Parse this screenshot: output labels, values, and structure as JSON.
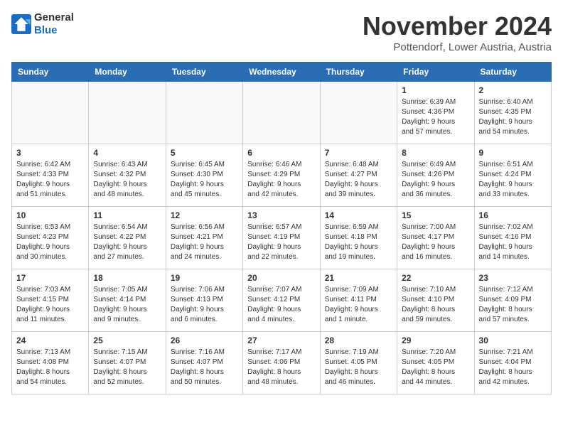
{
  "header": {
    "logo_line1": "General",
    "logo_line2": "Blue",
    "month": "November 2024",
    "location": "Pottendorf, Lower Austria, Austria"
  },
  "weekdays": [
    "Sunday",
    "Monday",
    "Tuesday",
    "Wednesday",
    "Thursday",
    "Friday",
    "Saturday"
  ],
  "weeks": [
    [
      {
        "day": "",
        "info": ""
      },
      {
        "day": "",
        "info": ""
      },
      {
        "day": "",
        "info": ""
      },
      {
        "day": "",
        "info": ""
      },
      {
        "day": "",
        "info": ""
      },
      {
        "day": "1",
        "info": "Sunrise: 6:39 AM\nSunset: 4:36 PM\nDaylight: 9 hours\nand 57 minutes."
      },
      {
        "day": "2",
        "info": "Sunrise: 6:40 AM\nSunset: 4:35 PM\nDaylight: 9 hours\nand 54 minutes."
      }
    ],
    [
      {
        "day": "3",
        "info": "Sunrise: 6:42 AM\nSunset: 4:33 PM\nDaylight: 9 hours\nand 51 minutes."
      },
      {
        "day": "4",
        "info": "Sunrise: 6:43 AM\nSunset: 4:32 PM\nDaylight: 9 hours\nand 48 minutes."
      },
      {
        "day": "5",
        "info": "Sunrise: 6:45 AM\nSunset: 4:30 PM\nDaylight: 9 hours\nand 45 minutes."
      },
      {
        "day": "6",
        "info": "Sunrise: 6:46 AM\nSunset: 4:29 PM\nDaylight: 9 hours\nand 42 minutes."
      },
      {
        "day": "7",
        "info": "Sunrise: 6:48 AM\nSunset: 4:27 PM\nDaylight: 9 hours\nand 39 minutes."
      },
      {
        "day": "8",
        "info": "Sunrise: 6:49 AM\nSunset: 4:26 PM\nDaylight: 9 hours\nand 36 minutes."
      },
      {
        "day": "9",
        "info": "Sunrise: 6:51 AM\nSunset: 4:24 PM\nDaylight: 9 hours\nand 33 minutes."
      }
    ],
    [
      {
        "day": "10",
        "info": "Sunrise: 6:53 AM\nSunset: 4:23 PM\nDaylight: 9 hours\nand 30 minutes."
      },
      {
        "day": "11",
        "info": "Sunrise: 6:54 AM\nSunset: 4:22 PM\nDaylight: 9 hours\nand 27 minutes."
      },
      {
        "day": "12",
        "info": "Sunrise: 6:56 AM\nSunset: 4:21 PM\nDaylight: 9 hours\nand 24 minutes."
      },
      {
        "day": "13",
        "info": "Sunrise: 6:57 AM\nSunset: 4:19 PM\nDaylight: 9 hours\nand 22 minutes."
      },
      {
        "day": "14",
        "info": "Sunrise: 6:59 AM\nSunset: 4:18 PM\nDaylight: 9 hours\nand 19 minutes."
      },
      {
        "day": "15",
        "info": "Sunrise: 7:00 AM\nSunset: 4:17 PM\nDaylight: 9 hours\nand 16 minutes."
      },
      {
        "day": "16",
        "info": "Sunrise: 7:02 AM\nSunset: 4:16 PM\nDaylight: 9 hours\nand 14 minutes."
      }
    ],
    [
      {
        "day": "17",
        "info": "Sunrise: 7:03 AM\nSunset: 4:15 PM\nDaylight: 9 hours\nand 11 minutes."
      },
      {
        "day": "18",
        "info": "Sunrise: 7:05 AM\nSunset: 4:14 PM\nDaylight: 9 hours\nand 9 minutes."
      },
      {
        "day": "19",
        "info": "Sunrise: 7:06 AM\nSunset: 4:13 PM\nDaylight: 9 hours\nand 6 minutes."
      },
      {
        "day": "20",
        "info": "Sunrise: 7:07 AM\nSunset: 4:12 PM\nDaylight: 9 hours\nand 4 minutes."
      },
      {
        "day": "21",
        "info": "Sunrise: 7:09 AM\nSunset: 4:11 PM\nDaylight: 9 hours\nand 1 minute."
      },
      {
        "day": "22",
        "info": "Sunrise: 7:10 AM\nSunset: 4:10 PM\nDaylight: 8 hours\nand 59 minutes."
      },
      {
        "day": "23",
        "info": "Sunrise: 7:12 AM\nSunset: 4:09 PM\nDaylight: 8 hours\nand 57 minutes."
      }
    ],
    [
      {
        "day": "24",
        "info": "Sunrise: 7:13 AM\nSunset: 4:08 PM\nDaylight: 8 hours\nand 54 minutes."
      },
      {
        "day": "25",
        "info": "Sunrise: 7:15 AM\nSunset: 4:07 PM\nDaylight: 8 hours\nand 52 minutes."
      },
      {
        "day": "26",
        "info": "Sunrise: 7:16 AM\nSunset: 4:07 PM\nDaylight: 8 hours\nand 50 minutes."
      },
      {
        "day": "27",
        "info": "Sunrise: 7:17 AM\nSunset: 4:06 PM\nDaylight: 8 hours\nand 48 minutes."
      },
      {
        "day": "28",
        "info": "Sunrise: 7:19 AM\nSunset: 4:05 PM\nDaylight: 8 hours\nand 46 minutes."
      },
      {
        "day": "29",
        "info": "Sunrise: 7:20 AM\nSunset: 4:05 PM\nDaylight: 8 hours\nand 44 minutes."
      },
      {
        "day": "30",
        "info": "Sunrise: 7:21 AM\nSunset: 4:04 PM\nDaylight: 8 hours\nand 42 minutes."
      }
    ]
  ]
}
